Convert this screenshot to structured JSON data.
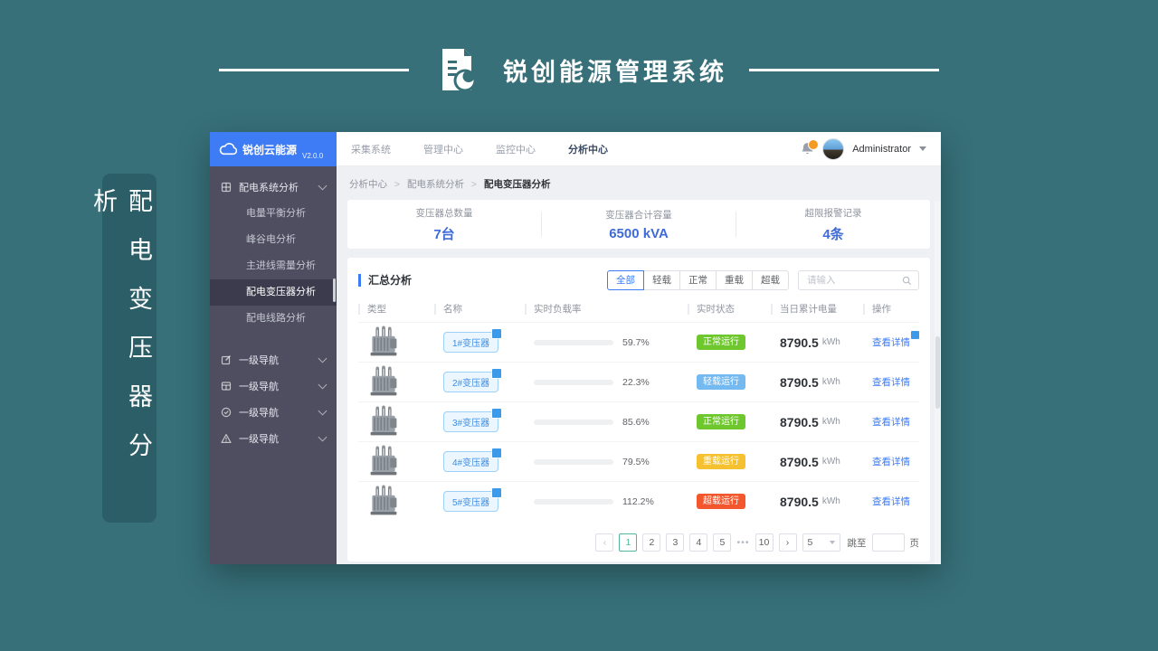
{
  "banner": {
    "title": "锐创能源管理系统",
    "side_label": "配电变压器分析"
  },
  "app": {
    "logo": {
      "brand": "锐创云能源",
      "version": "V2.0.0"
    },
    "topnav": {
      "items": [
        {
          "label": "采集系统"
        },
        {
          "label": "管理中心"
        },
        {
          "label": "监控中心"
        },
        {
          "label": "分析中心"
        }
      ],
      "active": "分析中心"
    },
    "user": {
      "name": "Administrator"
    },
    "breadcrumb": {
      "items": [
        "分析中心",
        "配电系统分析",
        "配电变压器分析"
      ],
      "separator": ">"
    },
    "sidebar": {
      "root": {
        "label": "配电系统分析",
        "icon": "grid-icon"
      },
      "children": [
        "电量平衡分析",
        "峰谷电分析",
        "主进线需量分析",
        "配电变压器分析",
        "配电线路分析"
      ],
      "active_child": "配电变压器分析",
      "extra": [
        {
          "label": "一级导航",
          "icon": "edit-icon"
        },
        {
          "label": "一级导航",
          "icon": "table-icon"
        },
        {
          "label": "一级导航",
          "icon": "check-circle-icon"
        },
        {
          "label": "一级导航",
          "icon": "warning-icon"
        }
      ]
    },
    "stats": [
      {
        "label": "变压器总数量",
        "value": "7台"
      },
      {
        "label": "变压器合计容量",
        "value": "6500 kVA"
      },
      {
        "label": "超限报警记录",
        "value": "4条"
      }
    ],
    "summary": {
      "title": "汇总分析",
      "filters": [
        "全部",
        "轻载",
        "正常",
        "重载",
        "超载"
      ],
      "active_filter": "全部",
      "search_placeholder": "请输入"
    },
    "table": {
      "columns": [
        "类型",
        "名称",
        "实时负载率",
        "实时状态",
        "当日累计电量",
        "操作"
      ],
      "action_label": "查看详情",
      "energy_unit": "kWh",
      "rows": [
        {
          "name": "1#变压器",
          "load_pct": 59.7,
          "load_text": "59.7%",
          "status": "正常运行",
          "status_color": "#6ec72d",
          "energy": "8790.5",
          "action_badge": true
        },
        {
          "name": "2#变压器",
          "load_pct": 22.3,
          "load_text": "22.3%",
          "status": "轻载运行",
          "status_color": "#74b9f0",
          "energy": "8790.5",
          "action_badge": false
        },
        {
          "name": "3#变压器",
          "load_pct": 85.6,
          "load_text": "85.6%",
          "status": "正常运行",
          "status_color": "#6ec72d",
          "energy": "8790.5",
          "action_badge": false
        },
        {
          "name": "4#变压器",
          "load_pct": 79.5,
          "load_text": "79.5%",
          "status": "重载运行",
          "status_color": "#f5c12e",
          "energy": "8790.5",
          "action_badge": false
        },
        {
          "name": "5#变压器",
          "load_pct": 112.2,
          "load_text": "112.2%",
          "status": "超载运行",
          "status_color": "#f2572d",
          "energy": "8790.5",
          "action_badge": false
        }
      ]
    },
    "pagination": {
      "prev": "‹",
      "next": "›",
      "pages": [
        "1",
        "2",
        "3",
        "4",
        "5",
        "•••",
        "10"
      ],
      "active_page": "1",
      "page_size": "5",
      "jump_prefix": "跳至",
      "jump_suffix": "页"
    }
  },
  "colors": {
    "accent_blue": "#3d7cf5",
    "banner_teal": "#377079",
    "sidebar_bg": "#4e4e60",
    "progress_blue": "#3d8fe6",
    "pagination_active": "#53b79e",
    "notification_badge": "#f59a23"
  }
}
